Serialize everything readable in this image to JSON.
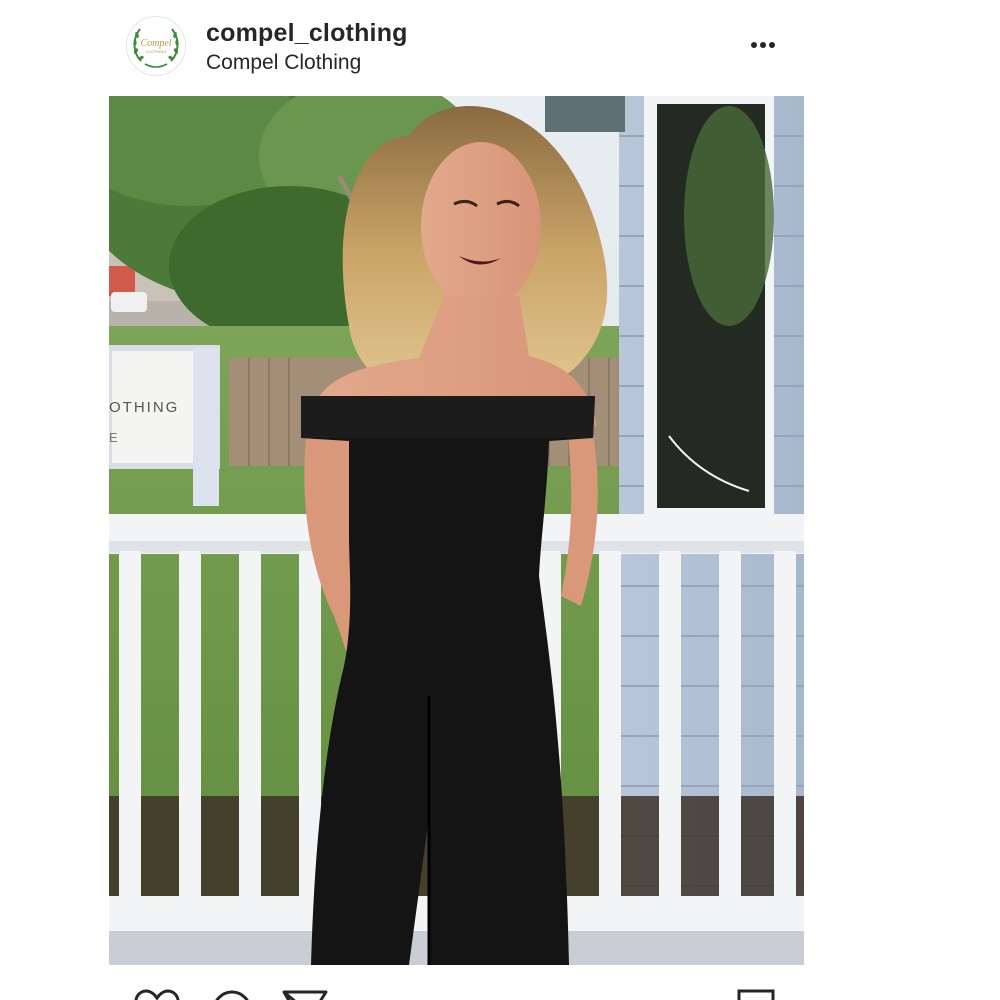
{
  "post": {
    "username": "compel_clothing",
    "full_name": "Compel Clothing",
    "avatar_text": "Compel",
    "avatar_subtext": "CLOTHING",
    "more_icon": "more-horizontal-icon"
  },
  "photo": {
    "sign_text_line1": "OTHING",
    "sign_text_line2": "E"
  },
  "actions": {
    "icons": [
      "heart-icon",
      "comment-icon",
      "share-icon",
      "bookmark-icon"
    ]
  },
  "colors": {
    "text": "#262626",
    "avatar_green": "#3c8a3c",
    "avatar_gold": "#b39a4a"
  }
}
